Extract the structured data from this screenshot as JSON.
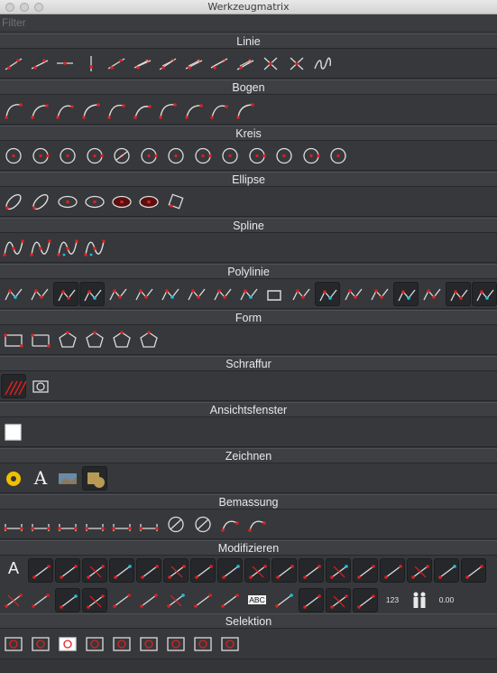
{
  "window": {
    "title": "Werkzeugmatrix"
  },
  "filter": {
    "placeholder": "Filter",
    "value": ""
  },
  "colors": {
    "accent": "#e02020",
    "cyan": "#20c0e0",
    "yellow": "#f0c000",
    "panel": "#333538"
  },
  "sections": [
    {
      "key": "linie",
      "label": "Linie",
      "tools": [
        "line-two-point-icon",
        "line-angle-icon",
        "line-horizontal-icon",
        "line-vertical-icon",
        "line-bisector-icon",
        "line-parallel-icon",
        "line-parallel-through-icon",
        "line-tangent-circle-icon",
        "line-tangent-two-circles-icon",
        "line-orthogonal-icon",
        "line-relative-angle-icon",
        "line-freehand-icon",
        "line-wave-icon"
      ]
    },
    {
      "key": "bogen",
      "label": "Bogen",
      "tools": [
        "arc-center-icon",
        "arc-three-point-icon",
        "arc-concentric-icon",
        "arc-tangential-icon",
        "arc-chord-icon",
        "arc-angle-icon",
        "arc-radius-icon",
        "arc-center-length-icon",
        "arc-inverted-icon",
        "arc-fillet-icon"
      ]
    },
    {
      "key": "kreis",
      "label": "Kreis",
      "tools": [
        "circle-center-point-icon",
        "circle-center-radius-icon",
        "circle-diameter-icon",
        "circle-two-point-icon",
        "circle-three-point-icon",
        "circle-concentric-icon",
        "circle-tangent-one-icon",
        "circle-tangent-two-icon",
        "circle-tangent-three-icon",
        "circle-tangent-point-icon",
        "circle-tangent-radius-icon",
        "circle-concentric-through-icon",
        "circle-inscribed-icon"
      ]
    },
    {
      "key": "ellipse",
      "label": "Ellipse",
      "tools": [
        "ellipse-axis-icon",
        "ellipse-arc-icon",
        "ellipse-center-icon",
        "ellipse-four-point-icon",
        "ellipse-inscribed-icon",
        "ellipse-foci-icon",
        "ellipse-rectangle-icon"
      ]
    },
    {
      "key": "spline",
      "label": "Spline",
      "tools": [
        "spline-control-points-icon",
        "spline-fit-points-icon",
        "spline-tangent-icon",
        "spline-closed-icon"
      ]
    },
    {
      "key": "polylinie",
      "label": "Polylinie",
      "tools": [
        "polyline-draw-icon",
        "polyline-segments-icon",
        "polyline-add-node-icon",
        "polyline-append-node-icon",
        "polyline-delete-node-icon",
        "polyline-delete-between-icon",
        "polyline-trim-icon",
        "polyline-equidistant-icon",
        "polyline-segment-icon",
        "polyline-arc-icon",
        "polyline-tangent-icon",
        "polyline-arrow-icon",
        "polyline-join-icon",
        "polyline-width-icon",
        "polyline-taper-icon",
        "polyline-bulge-icon",
        "polyline-reverse-icon",
        "polyline-explode-icon",
        "polyline-node-icon"
      ]
    },
    {
      "key": "form",
      "label": "Form",
      "tools": [
        "rectangle-icon",
        "rectangle-rounded-icon",
        "polygon-center-corner-icon",
        "polygon-two-corners-icon",
        "polygon-center-tangent-icon",
        "polygon-side-side-icon"
      ]
    },
    {
      "key": "schraffur",
      "label": "Schraffur",
      "tools": [
        "hatch-icon",
        "hatch-boundary-icon"
      ]
    },
    {
      "key": "ansichtsfenster",
      "label": "Ansichtsfenster",
      "tools": [
        "viewport-icon"
      ]
    },
    {
      "key": "zeichnen",
      "label": "Zeichnen",
      "tools": [
        "point-icon",
        "text-icon",
        "image-icon",
        "fill-icon"
      ]
    },
    {
      "key": "bemassung",
      "label": "Bemassung",
      "tools": [
        "dim-aligned-icon",
        "dim-angular-icon",
        "dim-horizontal-icon",
        "dim-vertical-icon",
        "dim-ordinate-icon",
        "dim-leader-icon",
        "dim-radial-icon",
        "dim-diameter-icon",
        "dim-arc-icon",
        "dim-angle-length-icon"
      ]
    },
    {
      "key": "modifizieren",
      "label": "Modifizieren",
      "tools": [
        "mod-text-size-icon",
        "mod-move-icon",
        "mod-rotate-icon",
        "mod-scale-icon",
        "mod-mirror-icon",
        "mod-bevel-icon",
        "mod-round-icon",
        "mod-offset-icon",
        "mod-revert-icon",
        "mod-stretch-icon",
        "mod-align-icon",
        "mod-trim-icon",
        "mod-extend-icon",
        "mod-divide-icon",
        "mod-break-icon",
        "mod-trim-both-icon",
        "mod-reset-icon",
        "mod-properties-icon",
        "mod-lengthen-icon",
        "mod-lengthen-both-icon",
        "mod-cut-icon",
        "mod-cut-two-icon",
        "mod-explode-icon",
        "mod-break-between-icon",
        "mod-split-icon",
        "mod-join-icon",
        "mod-explode-text-icon",
        "mod-text-icon",
        "mod-paint-icon",
        "mod-color-icon",
        "mod-arrange-icon",
        "mod-group-icon",
        "mod-number-icon",
        "mod-people-icon",
        "mod-decimal-icon"
      ],
      "number_label": "123",
      "decimal_label": "0.00",
      "text_label": "ABC"
    },
    {
      "key": "selektion",
      "label": "Selektion",
      "tools": [
        "select-window-icon",
        "select-intersected-icon",
        "select-contour-icon",
        "select-all-icon",
        "select-invert-icon",
        "select-layer-icon",
        "select-same-icon",
        "select-deselect-icon",
        "select-area-icon"
      ]
    }
  ],
  "zeichnen_text_label": "A"
}
